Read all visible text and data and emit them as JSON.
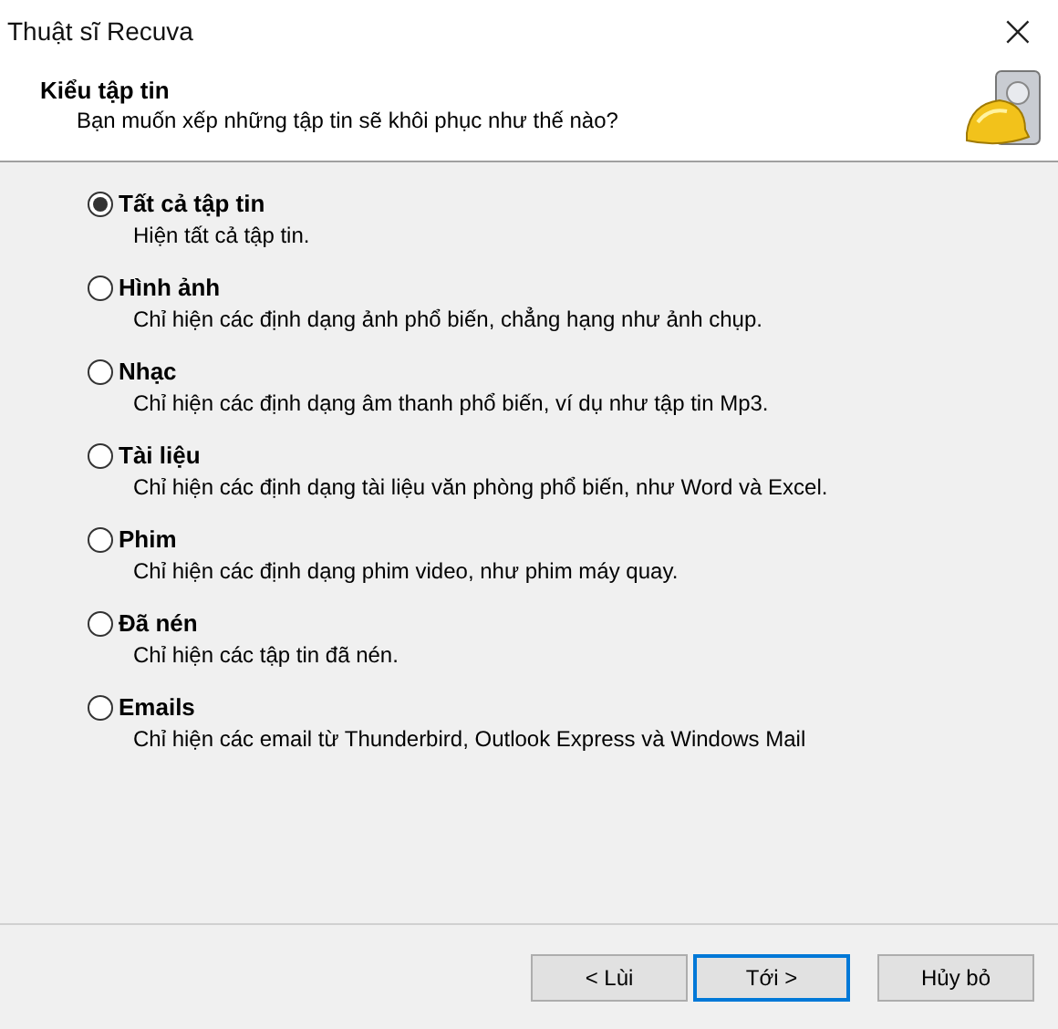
{
  "window": {
    "title": "Thuật sĩ Recuva",
    "close": "×"
  },
  "header": {
    "title": "Kiểu tập tin",
    "subtitle": "Bạn muốn xếp những tập tin sẽ khôi phục như thế nào?"
  },
  "options": [
    {
      "label": "Tất cả tập tin",
      "description": "Hiện tất cả tập tin.",
      "selected": true
    },
    {
      "label": "Hình ảnh",
      "description": "Chỉ hiện các định dạng ảnh phổ biến, chẳng hạng như ảnh chụp.",
      "selected": false
    },
    {
      "label": "Nhạc",
      "description": "Chỉ hiện các định dạng âm thanh phổ biến, ví dụ như tập tin Mp3.",
      "selected": false
    },
    {
      "label": "Tài liệu",
      "description": "Chỉ hiện các định dạng tài liệu văn phòng phổ biến, như Word và Excel.",
      "selected": false
    },
    {
      "label": "Phim",
      "description": "Chỉ hiện các định dạng phim video, như phim máy quay.",
      "selected": false
    },
    {
      "label": "Đã nén",
      "description": "Chỉ hiện các tập tin đã nén.",
      "selected": false
    },
    {
      "label": "Emails",
      "description": "Chỉ hiện các email từ Thunderbird, Outlook Express và Windows Mail",
      "selected": false
    }
  ],
  "buttons": [
    {
      "label": "< Lùi",
      "default": false
    },
    {
      "label": "Tới >",
      "default": true
    },
    {
      "label": "Hủy bỏ",
      "default": false
    }
  ]
}
